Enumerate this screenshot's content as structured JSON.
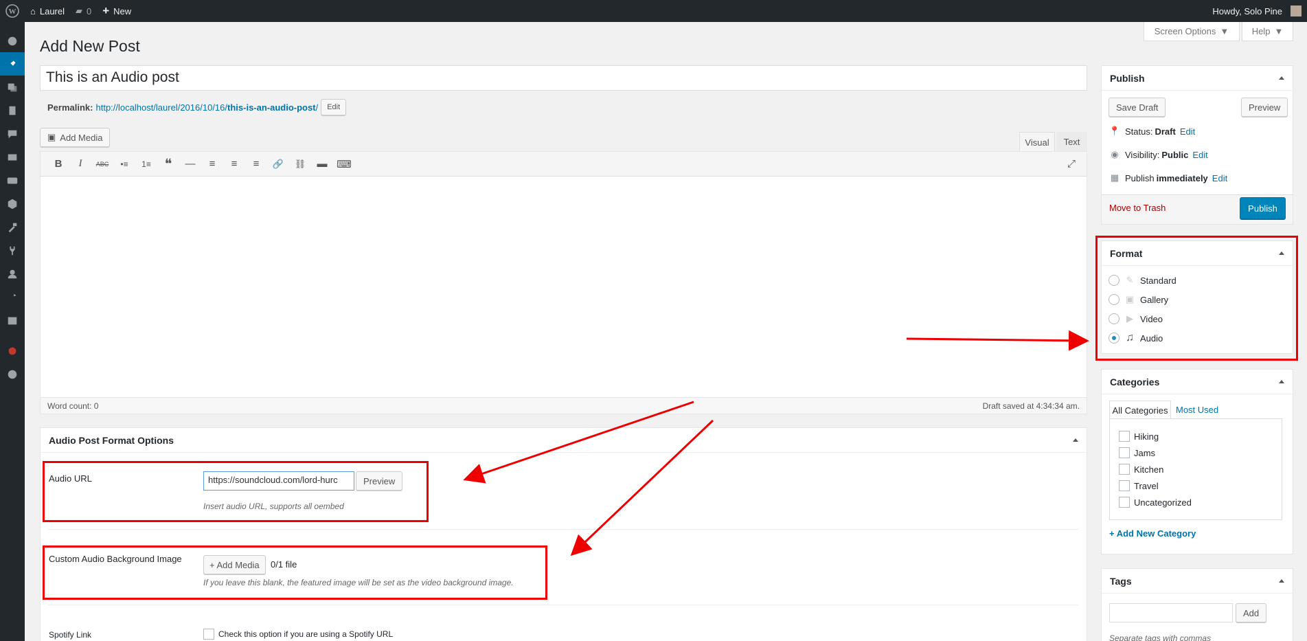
{
  "admin_bar": {
    "site": "Laurel",
    "comments": "0",
    "new": "New",
    "howdy": "Howdy, Solo Pine"
  },
  "screen_options": "Screen Options",
  "help": "Help",
  "page_title": "Add New Post",
  "post_title": "This is an Audio post",
  "permalink": {
    "label": "Permalink:",
    "base": "http://localhost/laurel/2016/10/16/",
    "slug": "this-is-an-audio-post",
    "trail": "/",
    "edit": "Edit"
  },
  "add_media": "Add Media",
  "tabs": {
    "visual": "Visual",
    "text": "Text"
  },
  "toolbar_icons": [
    "B",
    "I",
    "ABC",
    "•≡",
    "1≡",
    "❝",
    "—",
    "≡",
    "≡",
    "≡",
    "🔗",
    "⛓",
    "▬",
    "⌨"
  ],
  "editor_status": {
    "word_count": "Word count: 0",
    "draft_saved": "Draft saved at 4:34:34 am."
  },
  "publish": {
    "title": "Publish",
    "save_draft": "Save Draft",
    "preview": "Preview",
    "status_label": "Status:",
    "status_value": "Draft",
    "visibility_label": "Visibility:",
    "visibility_value": "Public",
    "publish_label": "Publish",
    "publish_value": "immediately",
    "edit": "Edit",
    "trash": "Move to Trash",
    "publish_btn": "Publish"
  },
  "format": {
    "title": "Format",
    "options": [
      "Standard",
      "Gallery",
      "Video",
      "Audio"
    ],
    "selected": "Audio"
  },
  "categories": {
    "title": "Categories",
    "tab_all": "All Categories",
    "tab_used": "Most Used",
    "items": [
      "Hiking",
      "Jams",
      "Kitchen",
      "Travel",
      "Uncategorized"
    ],
    "add": "+ Add New Category"
  },
  "tags": {
    "title": "Tags",
    "add": "Add",
    "hint": "Separate tags with commas"
  },
  "audio_options": {
    "title": "Audio Post Format Options",
    "audio_url_label": "Audio URL",
    "audio_url_value": "https://soundcloud.com/lord-hurc",
    "preview": "Preview",
    "audio_url_desc": "Insert audio URL, supports all oembed",
    "bg_label": "Custom Audio Background Image",
    "bg_add": "+ Add Media",
    "bg_count": "0/1 file",
    "bg_desc": "If you leave this blank, the featured image will be set as the video background image.",
    "spotify_label": "Spotify Link",
    "spotify_desc": "Check this option if you are using a Spotify URL"
  },
  "colors": {
    "admin_bar": "#23282d",
    "accent": "#0073aa",
    "annotation": "#ee0000"
  }
}
